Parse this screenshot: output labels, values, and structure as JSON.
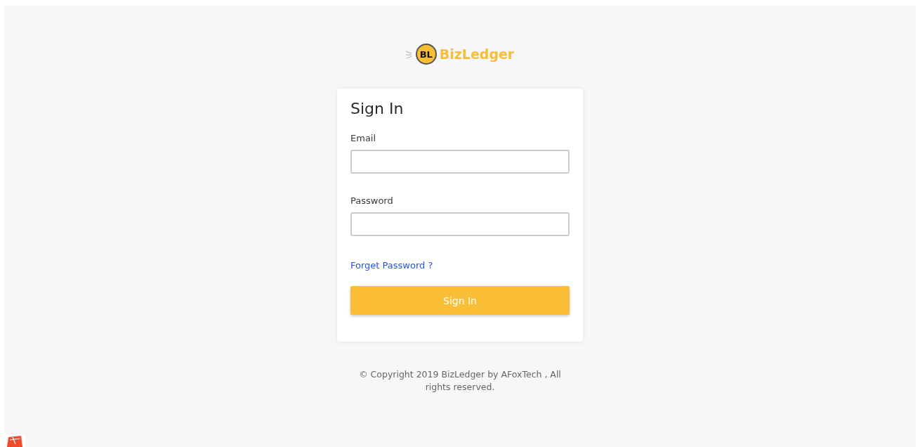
{
  "logo": {
    "badge": "BL",
    "name": "BizLedger"
  },
  "form": {
    "title": "Sign In",
    "fields": [
      {
        "label": "Email"
      },
      {
        "label": "Password"
      }
    ],
    "forgot_link": "Forget Password ?",
    "submit": "Sign In"
  },
  "footer": "© Copyright 2019 BizLedger by AFoxTech , All rights reserved."
}
